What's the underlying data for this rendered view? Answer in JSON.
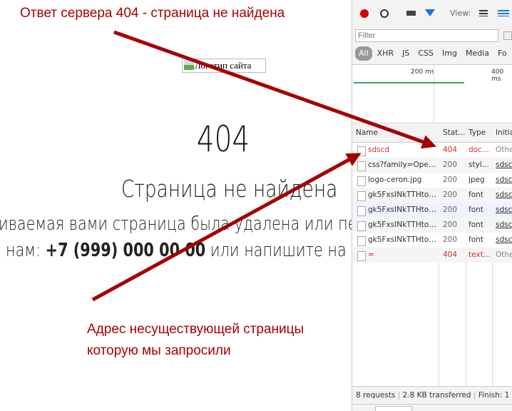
{
  "page": {
    "logo_alt": "Логотип сайта",
    "code": "404",
    "title": "Страница не найдена",
    "message": "иваемая вами страница была удалена или переп",
    "contact_prefix": "нам: ",
    "phone": "+7 (999) 000 00 00",
    "contact_suffix": " или напишите на e-m"
  },
  "annotations": {
    "top": "Ответ сервера 404 - страница не найдена",
    "bottom_line1": "Адрес несуществующей страницы",
    "bottom_line2": "которую мы запросили",
    "color": "#a50000"
  },
  "devtools": {
    "view_label": "View:",
    "filter_placeholder": "Filter",
    "types": [
      "All",
      "XHR",
      "JS",
      "CSS",
      "Img",
      "Media",
      "Fo"
    ],
    "timeline": [
      "200 ms",
      "400 ms"
    ],
    "columns": [
      "Name",
      "Stat...",
      "Type",
      "Initiat"
    ],
    "rows": [
      {
        "name": "sdscd",
        "status": "404",
        "type": "doc...",
        "initiator": "Othe",
        "error": true,
        "icon": "document-icon"
      },
      {
        "name": "css?family=Open...",
        "status": "200",
        "type": "styl...",
        "initiator": "sdscd",
        "error": false,
        "icon": "stylesheet-icon"
      },
      {
        "name": "logo-ceron.jpg",
        "status": "200",
        "type": "jpeg",
        "initiator": "sdscd",
        "error": false,
        "icon": "image-icon"
      },
      {
        "name": "gk5FxsINkTTHtojX...",
        "status": "200",
        "type": "font",
        "initiator": "sdscd",
        "error": false,
        "icon": "font-icon"
      },
      {
        "name": "gk5FxsINkTTHtojX...",
        "status": "200",
        "type": "font",
        "initiator": "sdscd",
        "error": false,
        "icon": "font-icon"
      },
      {
        "name": "gk5FxsINkTTHtojX...",
        "status": "200",
        "type": "font",
        "initiator": "sdscd",
        "error": false,
        "icon": "font-icon"
      },
      {
        "name": "gk5FxsINkTTHtojX...",
        "status": "200",
        "type": "font",
        "initiator": "sdscd",
        "error": false,
        "icon": "font-icon"
      },
      {
        "name": "=",
        "status": "404",
        "type": "text...",
        "initiator": "Othe",
        "error": true,
        "icon": "image-stack-icon"
      }
    ],
    "footer": {
      "requests": "8 requests",
      "transferred": "2.8 KB transferred",
      "finish": "Finish: 1"
    }
  }
}
